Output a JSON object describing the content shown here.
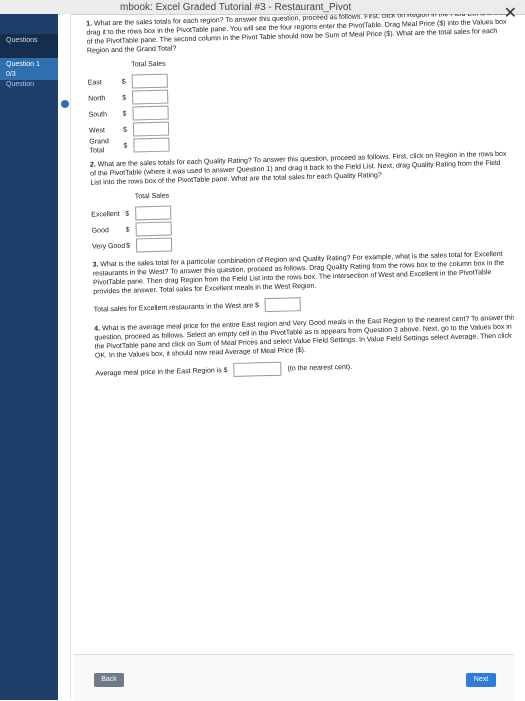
{
  "window": {
    "title": "mbook: Excel Graded Tutorial #3 - Restaurant_Pivot"
  },
  "sidebar": {
    "header": "Questions",
    "item": {
      "label": "Question 1",
      "count": "0/3",
      "status": "Question"
    }
  },
  "questions": {
    "q1": {
      "number": "1.",
      "text": "What are the sales totals for each region? To answer this question, proceed as follows. First, click on Region in the Field List and then drag it to the rows box in the PivotTable pane. You will see the four regions enter the PivotTable. Drag Meal Price ($) into the Values box of the PivotTable pane. The second column in the Pivot Table should now be Sum of Meal Price ($). What are the total sales for each Region and the Grand Total?",
      "table_header": "Total Sales",
      "rows": [
        "East",
        "North",
        "South",
        "West",
        "Grand Total"
      ]
    },
    "q2": {
      "number": "2.",
      "text": "What are the sales totals for each Quality Rating? To answer this question, proceed as follows. First, click on Region in the rows box of the PivotTable (where it was used to answer Question 1) and drag it back to the Field List. Next, drag Quality Rating from the Field List into the rows box of the PivotTable pane. What are the total sales for each Quality Rating?",
      "table_header": "Total Sales",
      "rows": [
        "Excellent",
        "Good",
        "Very Good"
      ]
    },
    "q3": {
      "number": "3.",
      "text": "What is the sales total for a particular combination of Region and Quality Rating? For example, what is the sales total for Excellent restaurants in the West? To answer this question, proceed as follows. Drag Quality Rating from the rows box to the column box in the PivotTable pane. Then drag Region from the Field List into the rows box. The intersection of West and Excellent in the PivotTable provides the answer. Total sales for Excellent meals in the West Region.",
      "answer_label": "Total sales for Excellent restaurants in the West are $"
    },
    "q4": {
      "number": "4.",
      "text": "What is the average meal price for the entire East region and Very Good meals in the East Region to the nearest cent? To answer this question, proceed as follows. Select an empty cell in the PivotTable as is appears from Question 3 above. Next, go to the Values box in the PivotTable pane and click on Sum of Meal Prices and select Value Field Settings. In Value Field Settings select Average. Then click OK. In the Values box, it should now read Average of Meal Price ($).",
      "answer_prefix": "Average meal price in the East Region is $",
      "answer_suffix": "(to the nearest cent)."
    }
  },
  "footer": {
    "back": "Back",
    "next": "Next"
  }
}
